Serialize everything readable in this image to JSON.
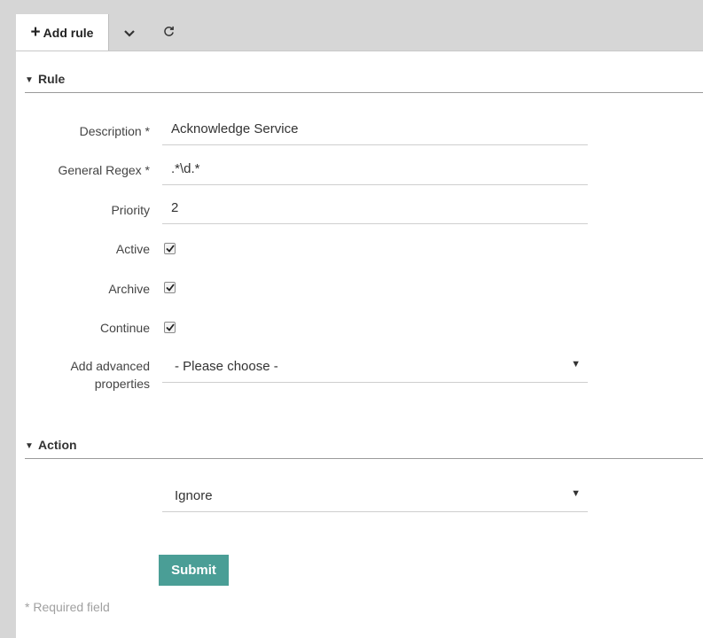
{
  "toolbar": {
    "add_rule_label": "Add rule",
    "add_icon": "plus-icon",
    "menu_icon": "chevron-down-icon",
    "reload_icon": "refresh-icon"
  },
  "sections": {
    "rule_title": "Rule",
    "action_title": "Action"
  },
  "form": {
    "description_label": "Description *",
    "description_value": "Acknowledge Service",
    "regex_label": "General Regex *",
    "regex_value": ".*\\d.*",
    "priority_label": "Priority",
    "priority_value": "2",
    "active_label": "Active",
    "active_checked": true,
    "archive_label": "Archive",
    "archive_checked": true,
    "continue_label": "Continue",
    "continue_checked": true,
    "advanced_label_line1": "Add advanced",
    "advanced_label_line2": "properties",
    "advanced_value": "- Please choose -",
    "action_value": "Ignore",
    "submit_label": "Submit",
    "required_note": "* Required field"
  },
  "colors": {
    "accent": "#4a9e96",
    "background": "#d6d6d6"
  }
}
